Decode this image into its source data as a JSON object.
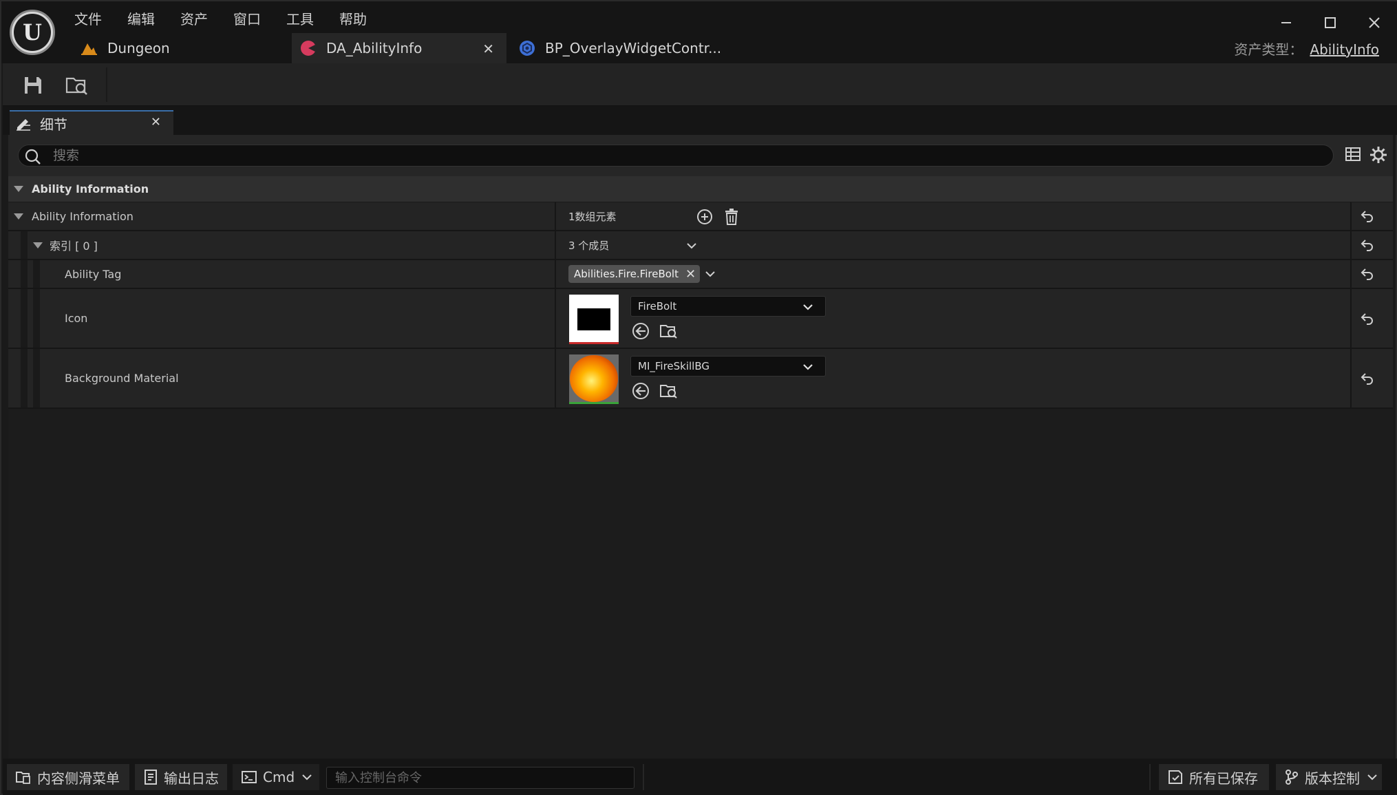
{
  "menubar": [
    "文件",
    "编辑",
    "资产",
    "窗口",
    "工具",
    "帮助"
  ],
  "tabs": [
    {
      "label": "Dungeon",
      "icon": "level-icon"
    },
    {
      "label": "DA_AbilityInfo",
      "icon": "data-asset-icon",
      "active": true
    },
    {
      "label": "BP_OverlayWidgetContr...",
      "icon": "blueprint-icon"
    }
  ],
  "asset_type": {
    "label": "资产类型：",
    "value": "AbilityInfo"
  },
  "panel": {
    "tab_label": "细节"
  },
  "search": {
    "placeholder": "搜索"
  },
  "category": {
    "label": "Ability Information"
  },
  "rows": {
    "ability_information": {
      "name": "Ability Information",
      "value": "1数组元素"
    },
    "index0": {
      "name": "索引 [ 0 ]",
      "value": "3 个成员"
    },
    "ability_tag": {
      "name": "Ability Tag",
      "tag": "Abilities.Fire.FireBolt"
    },
    "icon": {
      "name": "Icon",
      "asset": "FireBolt"
    },
    "background_material": {
      "name": "Background Material",
      "asset": "MI_FireSkillBG"
    }
  },
  "statusbar": {
    "content_drawer": "内容侧滑菜单",
    "output_log": "输出日志",
    "cmd": "Cmd",
    "cmd_placeholder": "输入控制台命令",
    "all_saved": "所有已保存",
    "source_control": "版本控制"
  },
  "colors": {
    "accent_tab": "#3a6ea8",
    "data_asset_icon": "#d63b5e",
    "blueprint_icon": "#3d6fd6",
    "level_icon": "#d88a1a"
  }
}
